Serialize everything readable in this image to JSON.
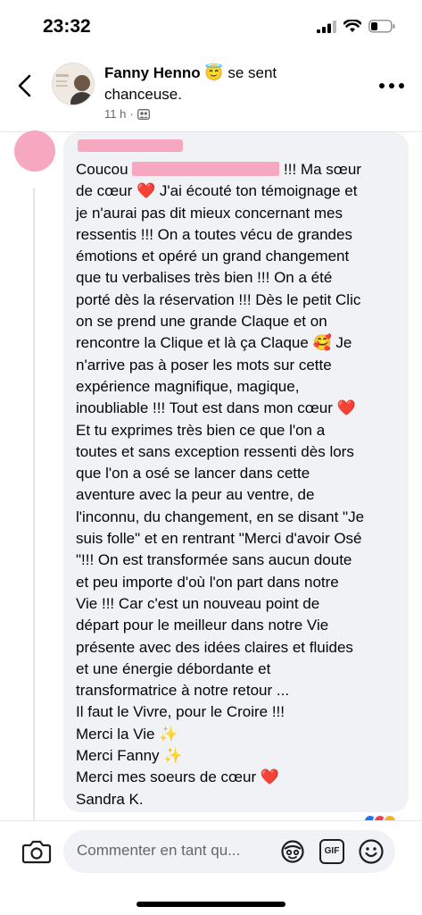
{
  "status_bar": {
    "time": "23:32"
  },
  "post_header": {
    "author_name": "Fanny Henno",
    "emoji": "😇",
    "activity_part1": "se sent",
    "activity_part2": "chanceuse.",
    "timestamp": "11 h",
    "separator": "·",
    "audience_icon": "friends-icon"
  },
  "comment": {
    "text_intro": "Coucou ",
    "text_after_redaction": "  !!! Ma sœur",
    "text_body": "de cœur ❤️  J'ai écouté ton témoignage et\nje n'aurai pas dit mieux concernant mes\nressentis !!! On a toutes vécu de grandes\némotions et opéré un grand changement\nque tu verbalises très bien !!! On a été\nporté dès la réservation !!! Dès le petit Clic\non se prend une grande Claque et on\nrencontre la Clique et là ça Claque 🥰  Je\nn'arrive pas à poser les mots sur cette\nexpérience magnifique, magique,\ninoubliable !!! Tout est dans mon cœur ❤️\nEt tu exprimes très bien ce que l'on a\ntoutes et sans exception ressenti dès lors\nque l'on a osé se lancer dans cette\naventure avec la peur au ventre, de\nl'inconnu, du changement, en se disant \"Je\nsuis folle\" et en rentrant \"Merci d'avoir Osé\n\"!!! On est transformée sans aucun doute\net peu importe d'où l'on part dans notre\nVie !!! Car c'est un nouveau point de\ndépart pour le meilleur dans notre Vie\nprésente avec des idées claires et fluides\net une énergie débordante et\ntransformatrice à notre retour ...\nIl faut le Vivre, pour le Croire !!!\nMerci la Vie ✨\nMerci Fanny ✨\nMerci mes soeurs de cœur ❤️\nSandra K."
  },
  "composer": {
    "placeholder": "Commenter en tant qu...",
    "gif_label": "GIF"
  },
  "colors": {
    "redaction_pink": "#f7a8c1",
    "bubble_bg": "#f0f2f5",
    "secondary_text": "#65676b"
  }
}
